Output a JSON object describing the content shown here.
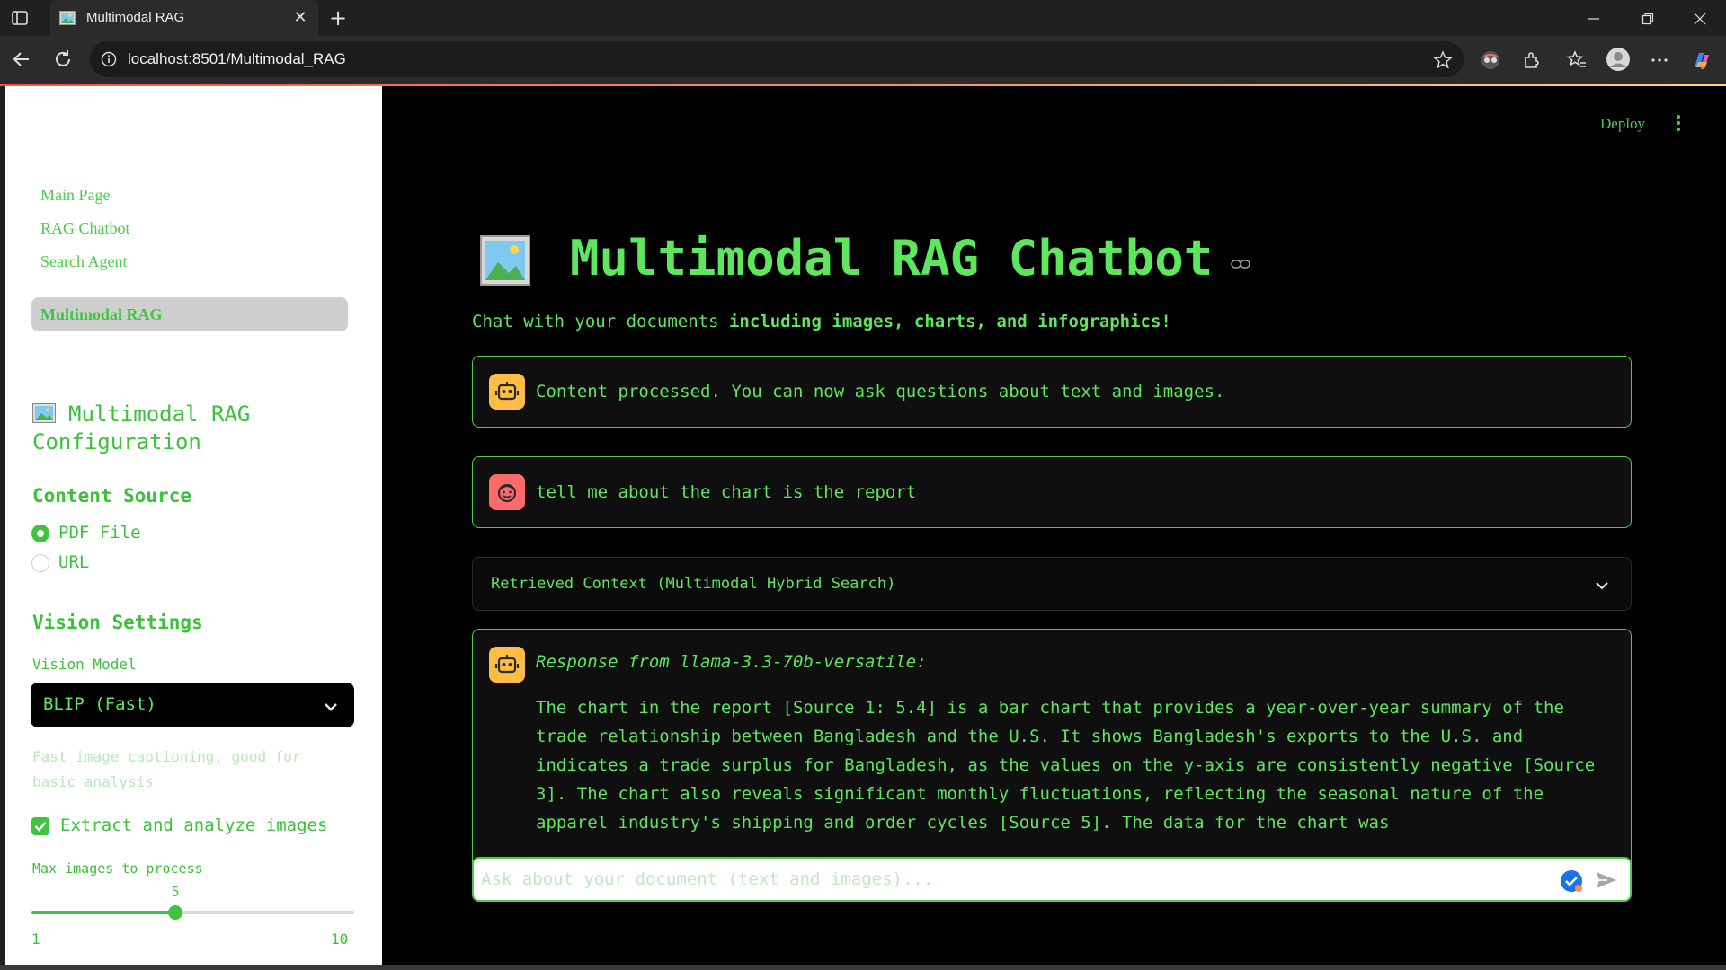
{
  "browser": {
    "tab_title": "Multimodal RAG",
    "url": "localhost:8501/Multimodal_RAG"
  },
  "sidebar": {
    "nav_items": [
      {
        "label": "Main Page"
      },
      {
        "label": "RAG Chatbot"
      },
      {
        "label": "Search Agent"
      },
      {
        "label": "Multimodal RAG",
        "active": true
      }
    ],
    "config_title": "Multimodal RAG Configuration",
    "content_source": {
      "title": "Content Source",
      "options": [
        "PDF File",
        "URL"
      ],
      "selected": "PDF File"
    },
    "vision_settings": {
      "title": "Vision Settings",
      "model_label": "Vision Model",
      "model_value": "BLIP (Fast)",
      "help": "Fast image captioning, good for basic analysis",
      "extract_label": "Extract and analyze images",
      "extract_checked": true,
      "max_images_label": "Max images to process",
      "slider": {
        "min": 1,
        "max": 10,
        "value": 5,
        "min_label": "1",
        "max_label": "10",
        "value_label": "5"
      }
    }
  },
  "header": {
    "deploy_label": "Deploy"
  },
  "main": {
    "title": "Multimodal RAG Chatbot",
    "subtitle_plain": "Chat with your documents ",
    "subtitle_bold": "including images, charts, and infographics!",
    "messages": [
      {
        "role": "assistant",
        "text": "Content processed. You can now ask questions about text and images."
      },
      {
        "role": "user",
        "text": "tell me about the chart is the report"
      }
    ],
    "expander_label": "Retrieved Context (Multimodal Hybrid Search)",
    "response": {
      "heading": "Response from llama-3.3-70b-versatile:",
      "body": "The chart in the report [Source 1: 5.4] is a bar chart that provides a year-over-year summary of the trade relationship between Bangladesh and the U.S. It shows Bangladesh's exports to the U.S. and indicates a trade surplus for Bangladesh, as the values on the y-axis are consistently negative [Source 3]. The chart also reveals significant monthly fluctuations, reflecting the seasonal nature of the apparel industry's shipping and order cycles [Source 5]. The data for the chart was"
    },
    "input_placeholder": "Ask about your document (text and images)..."
  },
  "colors": {
    "accent_green": "#4ccb4c",
    "text_green": "#5ee65e",
    "bot_avatar": "#ffbd45",
    "user_avatar": "#ff6b6b"
  },
  "icons": [
    "sidebar-toggle-icon",
    "image-emoji-icon",
    "close-icon",
    "plus-icon",
    "minimize-icon",
    "restore-icon",
    "back-icon",
    "reload-icon",
    "info-icon",
    "star-icon",
    "robot-icon",
    "face-icon",
    "chevron-down-icon",
    "link-icon",
    "send-icon",
    "kebab-menu-icon"
  ]
}
